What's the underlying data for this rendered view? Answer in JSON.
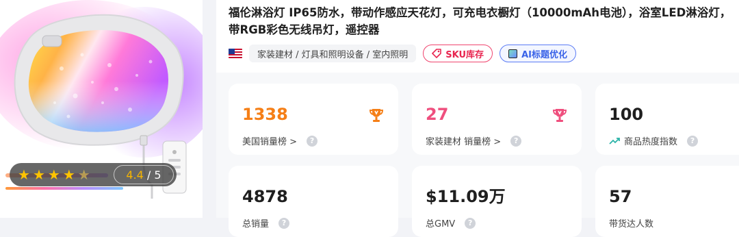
{
  "product": {
    "title_line1": "福伦淋浴灯 IP65防水，带动作感应天花灯，可充电衣橱灯（10000mAh电池），浴室LED淋浴灯，",
    "title_line2": "带RGB彩色无线吊灯，遥控器",
    "country_flag": "us-flag-icon",
    "category_path": "家装建材 / 灯具和照明设备 / 室内照明",
    "sku_button_label": "SKU库存",
    "ai_button_label": "AI标题优化",
    "rating": {
      "value": "4.4",
      "separator": " / ",
      "max": "5",
      "stars_filled": 4.4,
      "stars_total": 5
    }
  },
  "stats": [
    {
      "value": "1338",
      "label": "美国销量榜 >",
      "color": "#f57f17",
      "icon": "trophy-icon"
    },
    {
      "value": "27",
      "label": "家装建材 销量榜 >",
      "color": "#ef4f7e",
      "icon": "trophy-icon"
    },
    {
      "value": "100",
      "label": "商品热度指数",
      "color": "#1f1f1f",
      "icon": "trend-icon"
    },
    {
      "value": "4878",
      "label": "总销量",
      "color": "#1f1f1f"
    },
    {
      "value": "$11.09万",
      "label": "总GMV",
      "color": "#1f1f1f"
    },
    {
      "value": "57",
      "label": "带货达人数",
      "color": "#1f1f1f"
    }
  ],
  "colors": {
    "accent_orange": "#f57f17",
    "accent_pink": "#ef4f7e",
    "accent_blue": "#3a63e8",
    "sku_red": "#e8244f",
    "star": "#ffc400"
  }
}
